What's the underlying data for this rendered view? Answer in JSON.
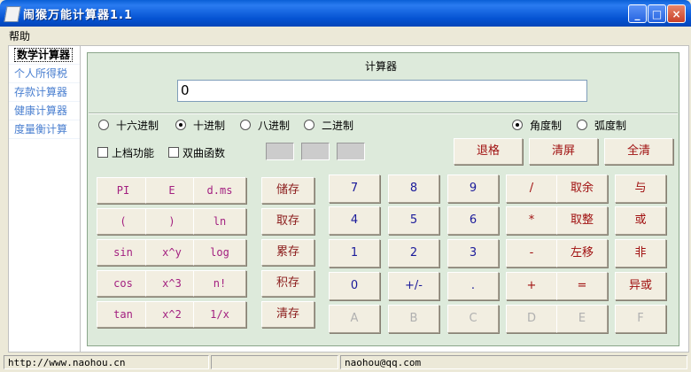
{
  "window": {
    "title": "闹猴万能计算器1.1",
    "min_label": "_",
    "max_label": "□",
    "close_label": "×"
  },
  "menu": {
    "help": "帮助"
  },
  "sidebar": {
    "items": [
      {
        "label": "数学计算器",
        "active": true
      },
      {
        "label": "个人所得税",
        "active": false
      },
      {
        "label": "存款计算器",
        "active": false
      },
      {
        "label": "健康计算器",
        "active": false
      },
      {
        "label": "度量衡计算",
        "active": false
      }
    ]
  },
  "calculator": {
    "title": "计算器",
    "display": "0",
    "radix": {
      "hex": "十六进制",
      "dec": "十进制",
      "oct": "八进制",
      "bin": "二进制",
      "selected": "十进制"
    },
    "angle": {
      "deg": "角度制",
      "rad": "弧度制",
      "selected": "角度制"
    },
    "options": {
      "shift": "上档功能",
      "hyperbolic": "双曲函数"
    },
    "top_buttons": {
      "backspace": "退格",
      "clear_screen": "清屏",
      "clear_all": "全清"
    },
    "functions": [
      [
        "PI",
        "E",
        "d.ms"
      ],
      [
        "(",
        ")",
        "ln"
      ],
      [
        "sin",
        "x^y",
        "log"
      ],
      [
        "cos",
        "x^3",
        "n!"
      ],
      [
        "tan",
        "x^2",
        "1/x"
      ]
    ],
    "memory": [
      "储存",
      "取存",
      "累存",
      "积存",
      "清存"
    ],
    "keypad": [
      [
        "7",
        "8",
        "9",
        "/",
        "取余",
        "与"
      ],
      [
        "4",
        "5",
        "6",
        "*",
        "取整",
        "或"
      ],
      [
        "1",
        "2",
        "3",
        "-",
        "左移",
        "非"
      ],
      [
        "0",
        "+/-",
        ".",
        "+",
        "=",
        "异或"
      ],
      [
        "A",
        "B",
        "C",
        "D",
        "E",
        "F"
      ]
    ]
  },
  "status": {
    "url": "http://www.naohou.cn",
    "email": "naohou@qq.com"
  }
}
